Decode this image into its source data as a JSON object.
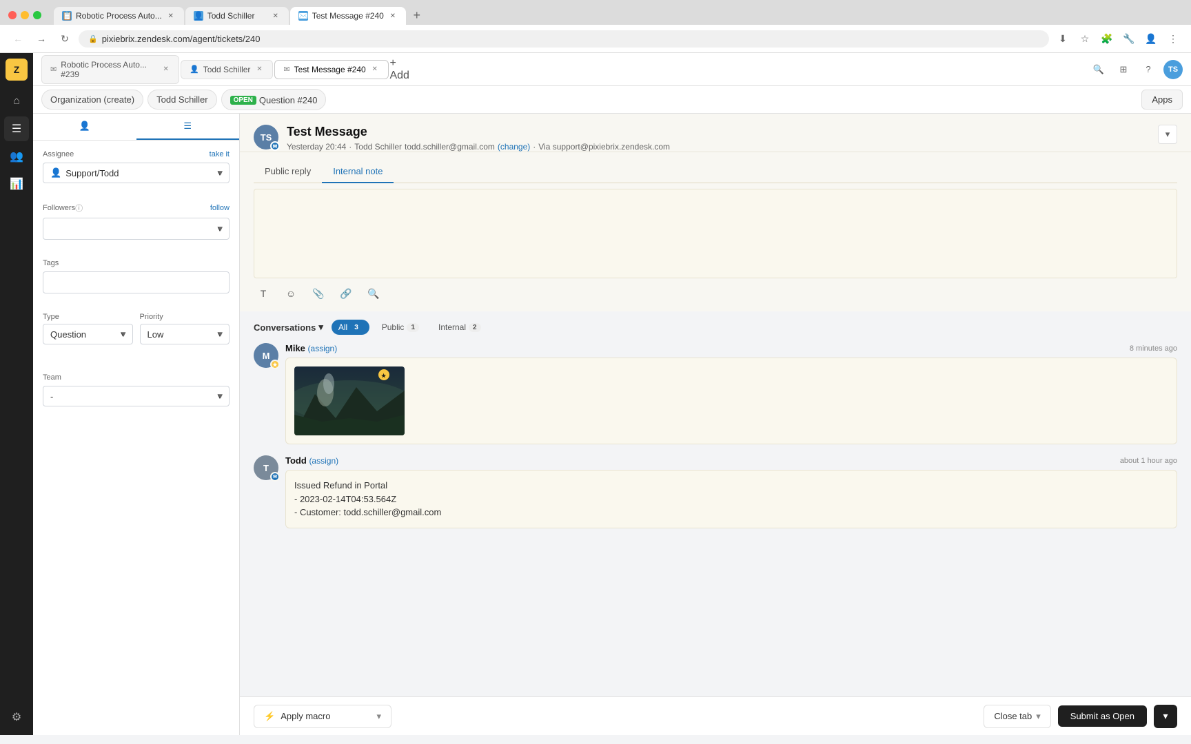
{
  "browser": {
    "tabs": [
      {
        "id": "tab1",
        "favicon": "📋",
        "title": "Robotic Process Auto...",
        "active": false,
        "label": "Robotic Process Auto..."
      },
      {
        "id": "tab2",
        "favicon": "👤",
        "title": "Todd Schiller",
        "active": false,
        "label": "Todd Schiller"
      },
      {
        "id": "tab3",
        "favicon": "✉️",
        "title": "Test Message #240",
        "active": true,
        "label": "Test Message #240"
      }
    ],
    "new_tab_label": "+",
    "address": "pixiebrix.zendesk.com/agent/tickets/240",
    "back_btn": "←",
    "forward_btn": "→",
    "refresh_btn": "↻"
  },
  "secondary_nav": {
    "items": [
      {
        "id": "org",
        "label": "Organization (create)"
      },
      {
        "id": "user",
        "label": "Todd Schiller"
      },
      {
        "id": "ticket",
        "label": "Question #240",
        "badge": "OPEN"
      }
    ],
    "apps_btn": "Apps"
  },
  "left_panel": {
    "tabs": [
      {
        "id": "user",
        "icon": "👤",
        "active": false
      },
      {
        "id": "info",
        "icon": "☰",
        "active": true
      }
    ],
    "assignee": {
      "label": "Assignee",
      "take_it": "take it",
      "value": "Support/Todd",
      "icon": "👤"
    },
    "followers": {
      "label": "Followers",
      "help_icon": "ⓘ",
      "follow_link": "follow"
    },
    "tags": {
      "label": "Tags"
    },
    "type": {
      "label": "Type",
      "value": "Question"
    },
    "priority": {
      "label": "Priority",
      "value": "Low"
    },
    "team": {
      "label": "Team",
      "value": "-"
    }
  },
  "ticket": {
    "subject": "Test Message",
    "avatar_initials": "TS",
    "timestamp": "Yesterday 20:44",
    "author": "Todd Schiller",
    "email": "todd.schiller@gmail.com",
    "change_link": "(change)",
    "via": "Via support@pixiebrix.zendesk.com"
  },
  "reply_tabs": [
    {
      "id": "public_reply",
      "label": "Public reply",
      "active": false
    },
    {
      "id": "internal_note",
      "label": "Internal note",
      "active": true
    }
  ],
  "toolbar": {
    "text_btn": "T",
    "emoji_btn": "☺",
    "attach_btn": "📎",
    "link_btn": "🔗",
    "search_btn": "🔍"
  },
  "conversations": {
    "title": "Conversations",
    "chevron": "▾",
    "tabs": [
      {
        "id": "all",
        "label": "All",
        "count": "3",
        "active": true
      },
      {
        "id": "public",
        "label": "Public",
        "count": "1",
        "active": false
      },
      {
        "id": "internal",
        "label": "Internal",
        "count": "2",
        "active": false
      }
    ]
  },
  "messages": [
    {
      "id": "msg1",
      "author": "Mike",
      "assign_label": "(assign)",
      "time": "8 minutes ago",
      "avatar_initials": "M",
      "has_image": true,
      "type": "image"
    },
    {
      "id": "msg2",
      "author": "Todd",
      "assign_label": "(assign)",
      "time": "about 1 hour ago",
      "avatar_initials": "T",
      "has_image": false,
      "type": "text",
      "lines": [
        "Issued Refund in Portal",
        "- 2023-02-14T04:53.564Z",
        "- Customer: todd.schiller@gmail.com"
      ]
    }
  ],
  "bottom_bar": {
    "lightning_icon": "⚡",
    "apply_macro_label": "Apply macro",
    "chevron_down": "▾",
    "close_tab_label": "Close tab",
    "close_tab_chevron": "▾",
    "submit_label": "Submit as Open",
    "submit_chevron": "▾"
  },
  "sidebar_icons": {
    "logo": "Z",
    "home": "⌂",
    "tickets": "☰",
    "users": "👥",
    "reports": "📊",
    "settings": "⚙"
  }
}
